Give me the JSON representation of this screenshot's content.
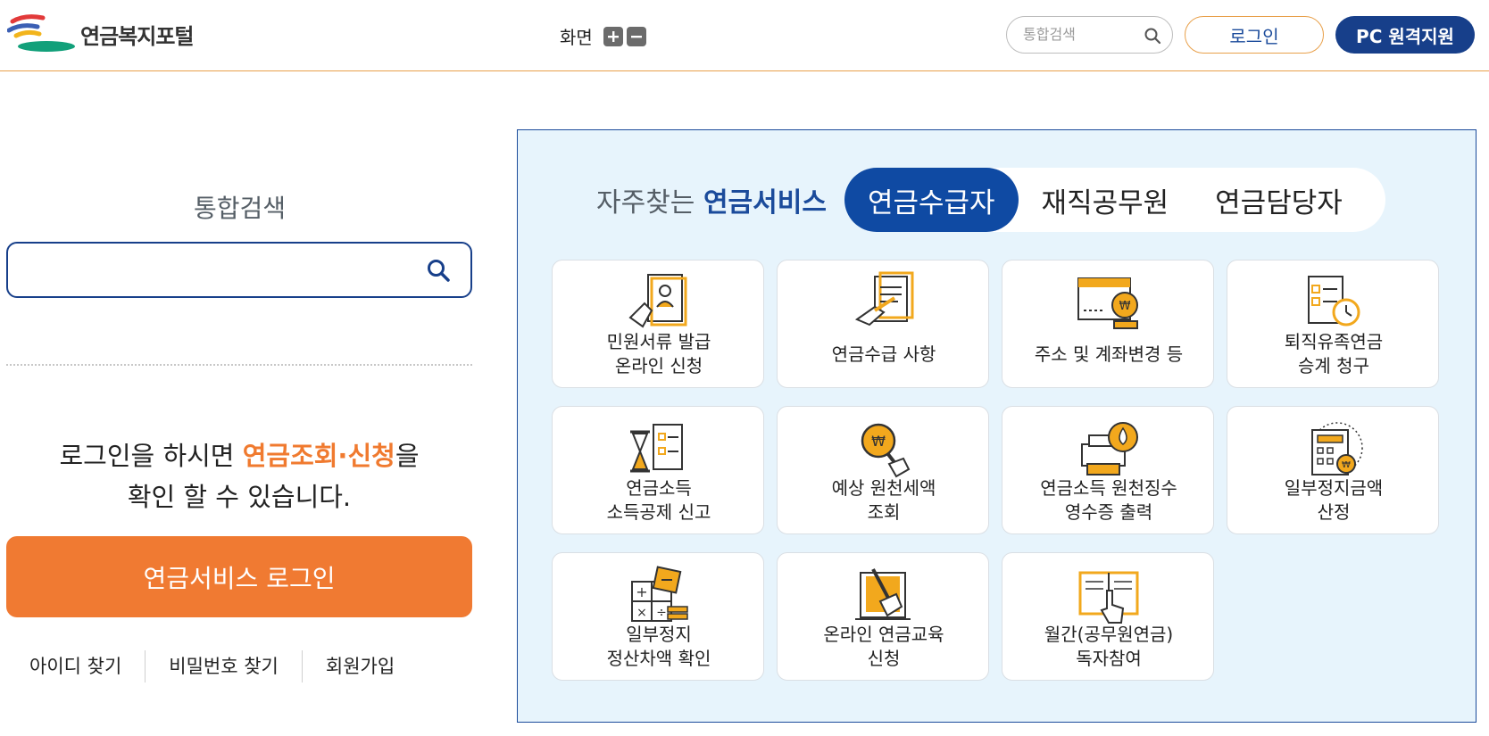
{
  "header": {
    "logo_text": "연금복지포털",
    "zoom_label": "화면",
    "search_placeholder": "통합검색",
    "login_label": "로그인",
    "remote_label": "PC 원격지원"
  },
  "left": {
    "search_title": "통합검색",
    "search_placeholder": "",
    "login_msg_before": "로그인을 하시면 ",
    "login_msg_highlight": "연금조회·신청",
    "login_msg_after": "을",
    "login_msg_line2": "확인 할 수 있습니다.",
    "service_login_label": "연금서비스 로그인",
    "links": [
      "아이디 찾기",
      "비밀번호 찾기",
      "회원가입"
    ]
  },
  "panel": {
    "title_prefix": "자주찾는 ",
    "title_highlight": "연금서비스",
    "tabs": [
      "연금수급자",
      "재직공무원",
      "연금담당자"
    ],
    "active_tab": 0,
    "services": [
      {
        "label": "민원서류 발급\n온라인 신청",
        "icon": "document-hand-icon"
      },
      {
        "label": "연금수급 사항",
        "icon": "document-pen-icon"
      },
      {
        "label": "주소 및 계좌변경 등",
        "icon": "bankbook-coin-icon"
      },
      {
        "label": "퇴직유족연금\n승계 청구",
        "icon": "checklist-stopwatch-icon"
      },
      {
        "label": "연금소득\n소득공제 신고",
        "icon": "hourglass-checklist-icon"
      },
      {
        "label": "예상 원천세액\n조회",
        "icon": "magnifier-won-icon"
      },
      {
        "label": "연금소득 원천징수\n영수증 출력",
        "icon": "printer-icon"
      },
      {
        "label": "일부정지금액\n산정",
        "icon": "calculator-won-icon"
      },
      {
        "label": "일부정지\n정산차액 확인",
        "icon": "math-symbols-icon"
      },
      {
        "label": "온라인 연금교육\n신청",
        "icon": "pen-tablet-icon"
      },
      {
        "label": "월간(공무원연금)\n독자참여",
        "icon": "book-pointer-icon"
      }
    ]
  },
  "colors": {
    "brand_blue": "#173f8a",
    "accent_orange": "#f07a32",
    "panel_bg": "#e7f4fc"
  }
}
